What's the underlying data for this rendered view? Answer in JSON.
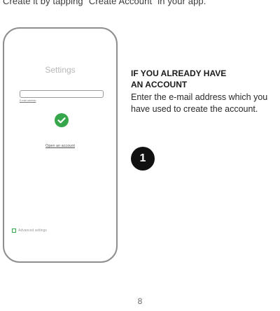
{
  "intro_text": "Create it by tapping “Create Account” in your app.",
  "phone": {
    "screen_title": "Settings",
    "email_caption": "E-mail address",
    "check_icon": "check-circle-icon",
    "open_account_link": "Open an account",
    "advanced_settings_label": "Advanced settings",
    "accent_color": "#35a64a"
  },
  "section": {
    "heading_line1": "IF YOU ALREADY HAVE",
    "heading_line2": "AN ACCOUNT",
    "body": "Enter the e-mail address which you have used to create the account."
  },
  "step_number": "1",
  "page_number": "8"
}
